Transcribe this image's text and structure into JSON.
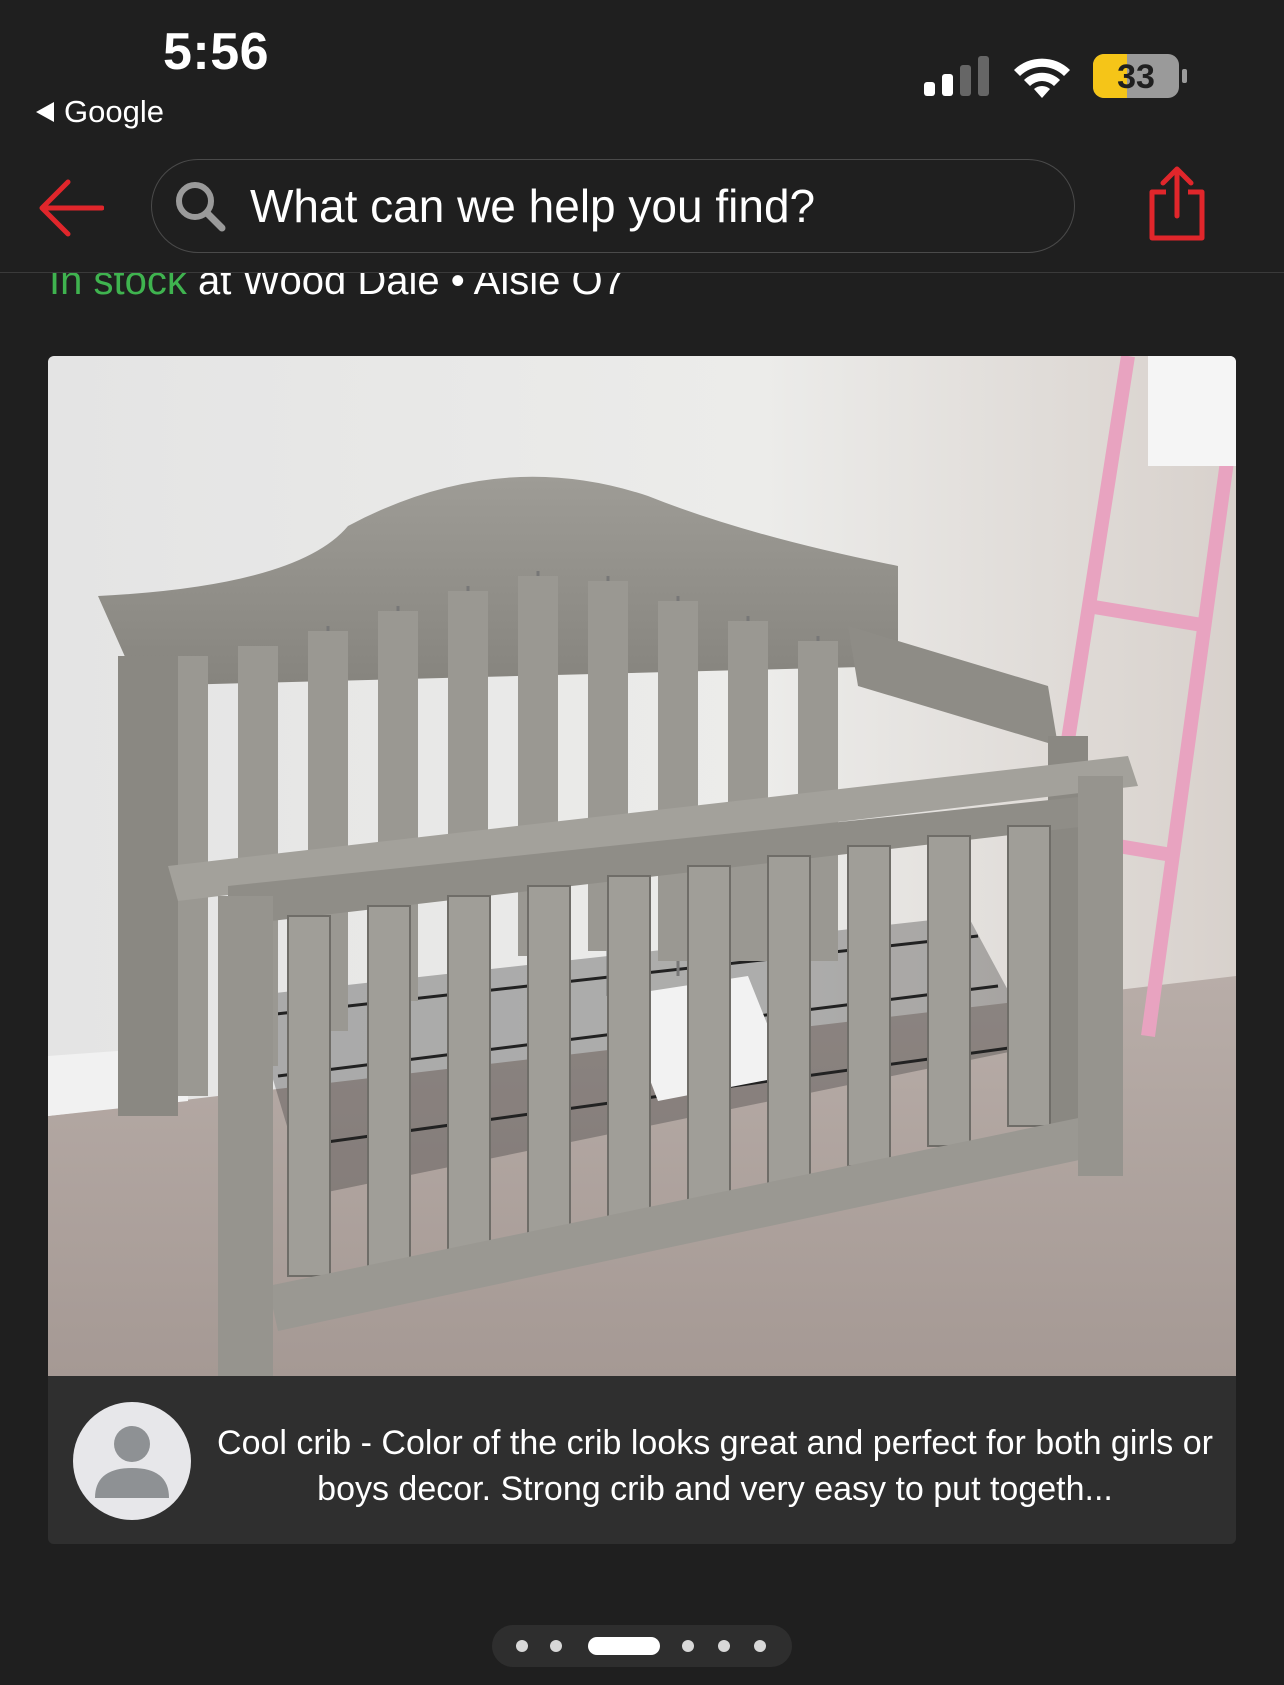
{
  "status_bar": {
    "time": "5:56",
    "back_app_label": "Google",
    "battery_level": "33",
    "signal_bars": 2,
    "icons": [
      "signal-icon",
      "wifi-icon",
      "battery-icon"
    ]
  },
  "navbar": {
    "back_icon": "back-arrow-icon",
    "search_placeholder": "What can we help you find?",
    "share_icon": "share-icon",
    "accent_color": "#e0262b"
  },
  "stock": {
    "status": "In stock",
    "location": "at Wood Dale",
    "separator": "•",
    "aisle": "Aisle O7",
    "status_color": "#3fb34f"
  },
  "review_card": {
    "image_alt": "Gray wood crib in a nursery",
    "avatar_icon": "user-avatar-icon",
    "caption": "Cool crib - Color of the crib looks great and perfect for both girls or boys decor. Strong crib and very easy to put togeth..."
  },
  "pager": {
    "total": 6,
    "active_index": 2
  }
}
